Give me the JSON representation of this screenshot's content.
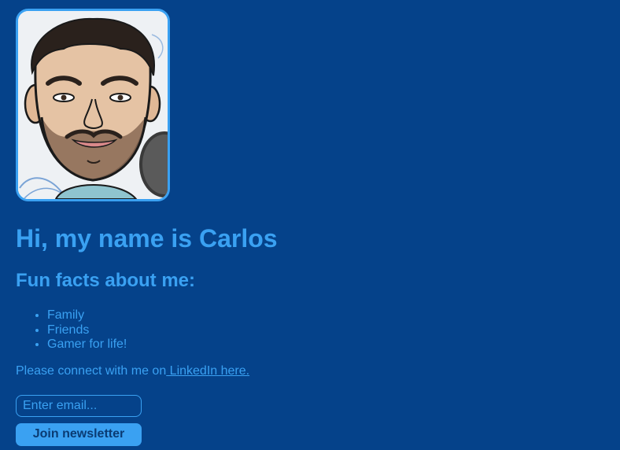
{
  "profile": {
    "avatar_icon": "caricature-portrait"
  },
  "heading": "Hi, my name is Carlos",
  "subheading": "Fun facts about me:",
  "facts": [
    "Family",
    "Friends",
    "Gamer for life!"
  ],
  "connect": {
    "text": "Please connect with me on",
    "link_label": " LinkedIn here."
  },
  "newsletter": {
    "email_placeholder": "Enter email...",
    "email_value": "",
    "button_label": "Join newsletter"
  },
  "colors": {
    "background": "#05428a",
    "accent": "#3aa1f2",
    "button_text": "#0a3b73"
  }
}
